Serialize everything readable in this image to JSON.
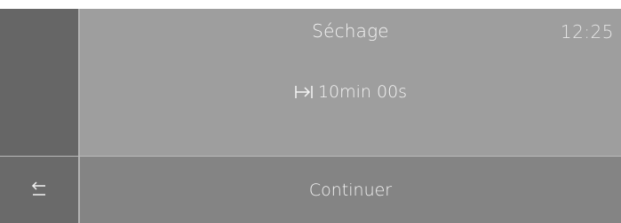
{
  "header": {
    "title": "Séchage",
    "clock": "12:25"
  },
  "timer": {
    "icon": "duration-arrow-icon",
    "value": "10min 00s"
  },
  "footer": {
    "back_icon": "back-arrow-icon",
    "continue_label": "Continuer"
  }
}
